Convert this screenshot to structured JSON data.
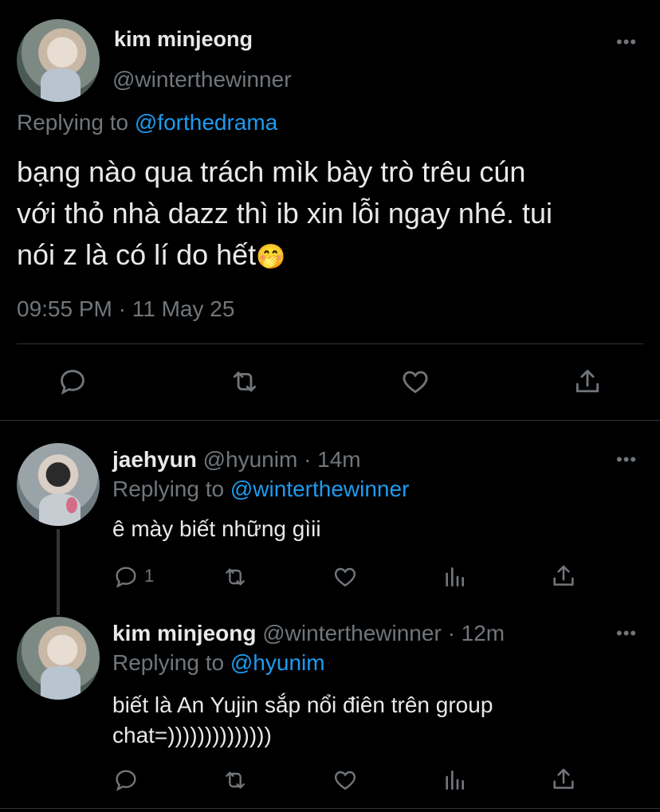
{
  "main_tweet": {
    "display_name": "kim minjeong",
    "handle": "@winterthewinner",
    "replying_prefix": "Replying to",
    "replying_to": "@forthedrama",
    "text_line1": "bạng nào qua trách mìk bày trò trêu cún",
    "text_line2": "với thỏ nhà dazz thì ib xin lỗi ngay nhé. tui",
    "text_line3": "nói z là có lí do hết",
    "emoji": "🤭",
    "timestamp": "09:55 PM · 11 May 25",
    "actions": {
      "reply_icon": "reply-icon",
      "retweet_icon": "retweet-icon",
      "like_icon": "heart-icon",
      "share_icon": "share-icon"
    }
  },
  "replies": [
    {
      "display_name": "jaehyun",
      "handle": "@hyunim",
      "time": "· 14m",
      "replying_prefix": "Replying to",
      "replying_to": "@winterthewinner",
      "text": "ê mày biết những gìii",
      "reply_count": "1"
    },
    {
      "display_name": "kim minjeong",
      "handle": "@winterthewinner",
      "time": "· 12m",
      "replying_prefix": "Replying to",
      "replying_to": "@hyunim",
      "text_line1": "biết là An Yujin sắp nổi điên trên group",
      "text_line2": "chat=))))))))))))))"
    }
  ],
  "colors": {
    "background": "#000000",
    "text": "#e7e9ea",
    "secondary": "#71767b",
    "accent": "#1d9bf0",
    "divider": "#2f3336"
  }
}
